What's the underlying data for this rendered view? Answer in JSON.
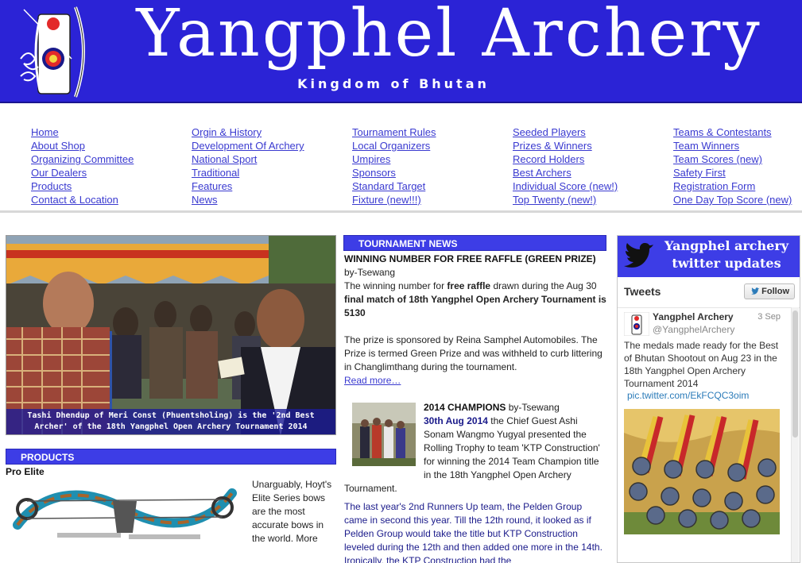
{
  "header": {
    "title": "Yangphel Archery",
    "subtitle": "Kingdom of Bhutan"
  },
  "nav": {
    "columns": [
      [
        "Home",
        "About Shop",
        "Organizing Committee",
        "Our Dealers",
        "Products",
        "Contact & Location"
      ],
      [
        "Orgin & History",
        "Development Of Archery",
        "National Sport",
        "Traditional",
        "Features",
        "News"
      ],
      [
        "Tournament Rules",
        "Local Organizers",
        "Umpires",
        "Sponsors",
        "Standard Target",
        "Fixture (new!!!)"
      ],
      [
        "Seeded Players",
        "Prizes & Winners",
        "Record Holders",
        "Best Archers",
        "Individual Score (new!)",
        "Top Twenty (new!)"
      ],
      [
        "Teams & Contestants",
        "Team Winners",
        "Team Scores (new)",
        "Safety First",
        "Registration Form",
        "One Day Top Score (new)"
      ]
    ]
  },
  "featured": {
    "caption": "Tashi Dhendup of Meri Const (Phuentsholing) is the '2nd Best Archer' of the 18th Yangphel Open Archery Tournament 2014"
  },
  "products": {
    "heading": "PRODUCTS",
    "name": "Pro Elite",
    "text": "Unarguably, Hoyt's Elite Series bows are the most accurate bows in the world. More"
  },
  "news": {
    "heading": "TOURNAMENT NEWS",
    "item1": {
      "title": "WINNING NUMBER FOR FREE RAFFLE (GREEN PRIZE)",
      "byline": " by-Tsewang",
      "p1_a": "The winning number for ",
      "p1_b": "free raffle",
      "p1_c": " drawn during the Aug 30 ",
      "p1_d": "final match of 18th Yangphel Open Archery Tournament is 5130",
      "p2": "The prize is sponsored by Reina Samphel Automobiles. The Prize is termed Green Prize and was withheld to curb littering in Changlimthang during the tournament.",
      "read_more": "Read more…"
    },
    "item2": {
      "title": "2014 CHAMPIONS",
      "byline": " by-Tsewang",
      "date": "30th Aug 2014",
      "p1": "        the Chief Guest Ashi Sonam Wangmo Yugyal presented the Rolling Trophy to team 'KTP Construction' for winning the 2014 Team Champion title in the 18th Yangphel Open Archery Tournament.",
      "p2": "The last year's 2nd Runners Up team, the Pelden Group came in second this year. Till the 12th round, it looked as if Pelden Group would take the title but KTP Construction leveled during the 12th and then added one more in the 14th. Ironically, the KTP Construction had the"
    }
  },
  "twitter": {
    "banner_title": "Yangphel archery twitter updates",
    "tweets_label": "Tweets",
    "follow_label": "Follow",
    "tweet": {
      "name": "Yangphel Archery",
      "handle": "@YangphelArchery",
      "date": "3 Sep",
      "text": "The medals made ready for the Best of Bhutan Shootout on Aug 23 in the 18th Yangphel Open Archery Tournament 2014",
      "link": "pic.twitter.com/EkFCQC3oim"
    }
  },
  "colors": {
    "header_bg": "#2b23d6",
    "section_bar": "#3d3de6",
    "link": "#3a3ad0",
    "twitter_link": "#2b7bb9"
  }
}
